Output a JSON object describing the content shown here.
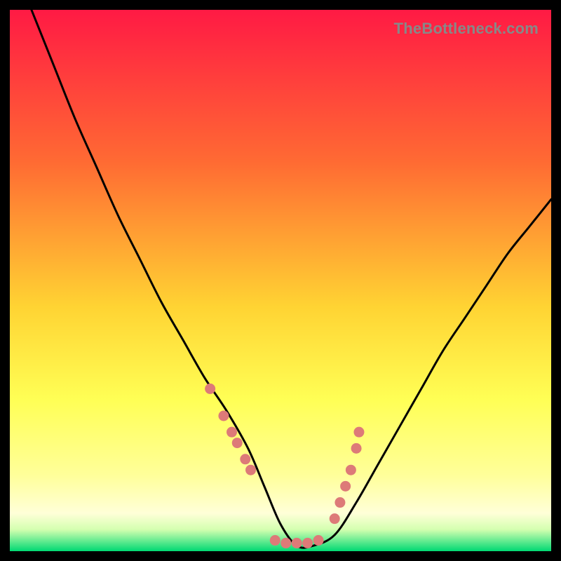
{
  "watermark": "TheBottleneck.com",
  "colors": {
    "frame": "#000000",
    "gradient_top": "#ff1a44",
    "gradient_mid1": "#ff7a2f",
    "gradient_mid2": "#ffe233",
    "gradient_mid3": "#ffff66",
    "gradient_low": "#ffffc0",
    "gradient_bottom": "#00e676",
    "curve": "#000000",
    "marker": "#dd7a78"
  },
  "chart_data": {
    "type": "line",
    "title": "",
    "xlabel": "",
    "ylabel": "",
    "xlim": [
      0,
      100
    ],
    "ylim": [
      0,
      100
    ],
    "series": [
      {
        "name": "bottleneck-curve",
        "x": [
          4,
          8,
          12,
          16,
          20,
          24,
          28,
          32,
          36,
          40,
          44,
          47,
          50,
          53,
          56,
          60,
          64,
          68,
          72,
          76,
          80,
          84,
          88,
          92,
          96,
          100
        ],
        "y": [
          100,
          90,
          80,
          71,
          62,
          54,
          46,
          39,
          32,
          26,
          19,
          12,
          5,
          1,
          1,
          3,
          9,
          16,
          23,
          30,
          37,
          43,
          49,
          55,
          60,
          65
        ]
      }
    ],
    "markers": {
      "name": "highlighted-points",
      "x": [
        37,
        39.5,
        41,
        42,
        43.5,
        44.5,
        49,
        51,
        53,
        55,
        57,
        60,
        61,
        62,
        63,
        64,
        64.5
      ],
      "y": [
        30,
        25,
        22,
        20,
        17,
        15,
        2,
        1.5,
        1.5,
        1.5,
        2,
        6,
        9,
        12,
        15,
        19,
        22
      ]
    }
  }
}
